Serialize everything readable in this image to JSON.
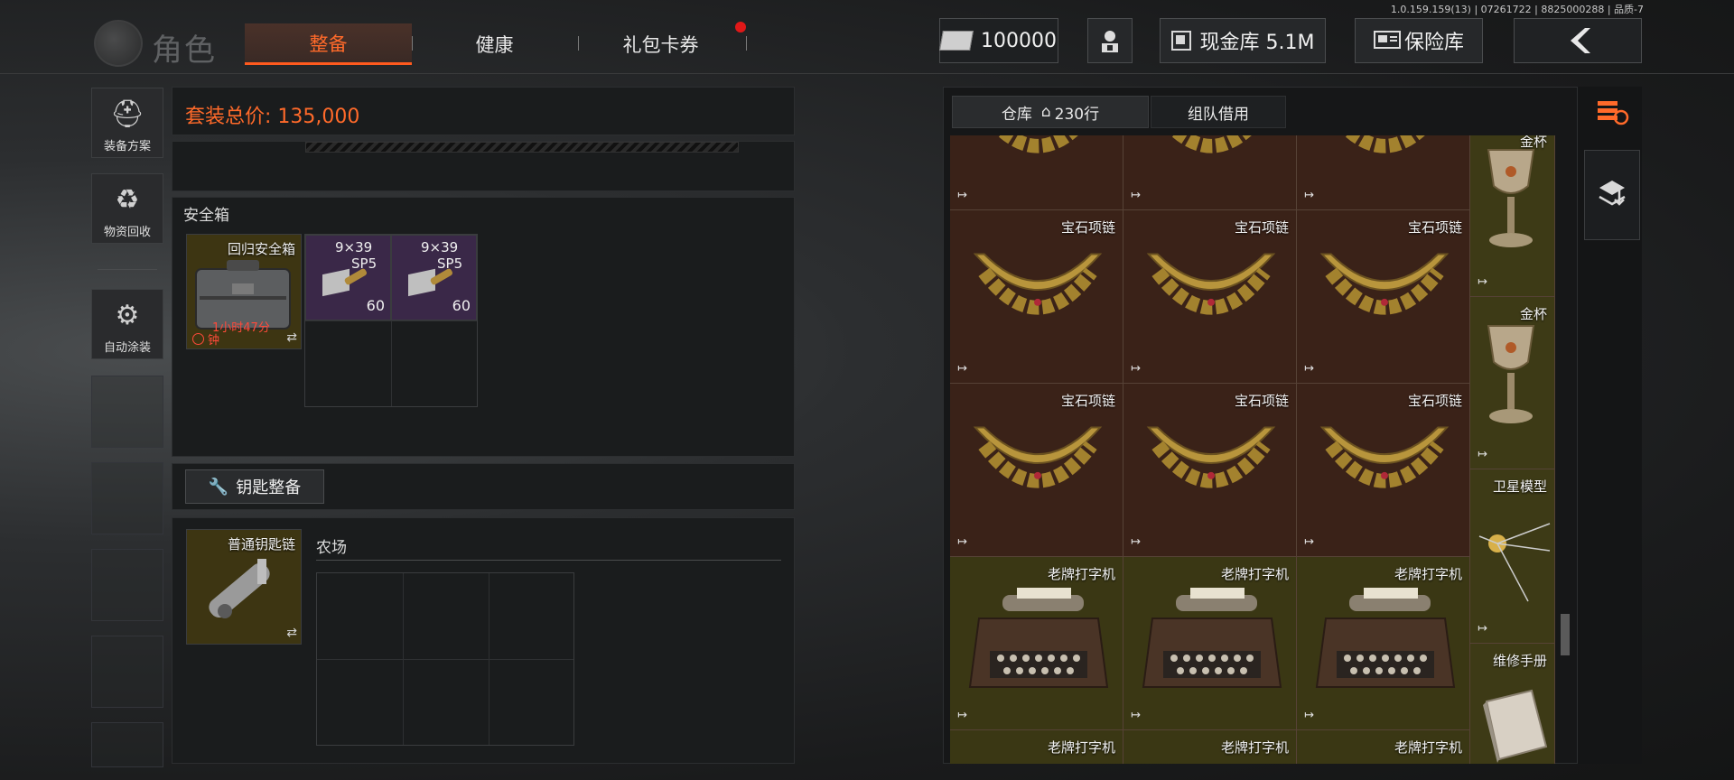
{
  "version_text": "1.0.159.159(13) | 07261722 | 8825000288 | 品质-7",
  "page_title": "角色",
  "tabs": [
    {
      "label": "整备"
    },
    {
      "label": "健康"
    },
    {
      "label": "礼包卡券"
    }
  ],
  "currency": {
    "amount": "100000"
  },
  "cash_vault": {
    "label": "现金库 5.1M"
  },
  "safe_vault": {
    "label": "保险库"
  },
  "sidebar": {
    "items": [
      {
        "label": "装备方案"
      },
      {
        "label": "物资回收"
      },
      {
        "label": "自动涂装"
      }
    ]
  },
  "loadout": {
    "total_label": "套装总价: 135,000"
  },
  "safe_box": {
    "label": "安全箱",
    "case": {
      "name": "回归安全箱",
      "timer": "1小时47分",
      "timer2": "钟"
    },
    "ammo": [
      {
        "name": "9×39",
        "sub": "SP5",
        "qty": "60"
      },
      {
        "name": "9×39",
        "sub": "SP5",
        "qty": "60"
      }
    ]
  },
  "key_section": {
    "button_label": "钥匙整备",
    "keychain": {
      "name": "普通钥匙链"
    },
    "area_label": "农场"
  },
  "warehouse": {
    "tabs": [
      {
        "label": "仓库"
      },
      {
        "label": "230行"
      },
      {
        "label": "组队借用"
      }
    ],
    "rows": [
      {
        "items": [
          {
            "name": ""
          },
          {
            "name": ""
          },
          {
            "name": ""
          }
        ],
        "side": {
          "name": "金杯"
        }
      },
      {
        "items": [
          {
            "name": "宝石项链"
          },
          {
            "name": "宝石项链"
          },
          {
            "name": "宝石项链"
          }
        ],
        "side": {
          "name": "金杯"
        }
      },
      {
        "items": [
          {
            "name": "宝石项链"
          },
          {
            "name": "宝石项链"
          },
          {
            "name": "宝石项链"
          }
        ],
        "side": {
          "name": "卫星模型"
        }
      },
      {
        "items": [
          {
            "name": "老牌打字机"
          },
          {
            "name": "老牌打字机"
          },
          {
            "name": "老牌打字机"
          }
        ],
        "side": {
          "name": "维修手册"
        }
      },
      {
        "items": [
          {
            "name": "老牌打字机"
          },
          {
            "name": "老牌打字机"
          },
          {
            "name": "老牌打字机"
          }
        ]
      }
    ]
  },
  "colors": {
    "accent": "#ff6a2a",
    "notification": "#e01818",
    "cell_brown": "#3a2218",
    "cell_olive": "#3a3714",
    "cell_purple": "#3a2848"
  }
}
